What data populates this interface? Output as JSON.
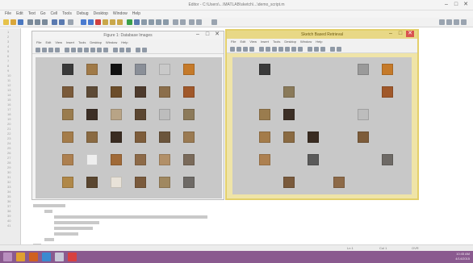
{
  "window": {
    "title": "Editor - C:\\Users\\...\\MATLAB\\sketch\\...\\demo_script.m",
    "controls": [
      "–",
      "□",
      "✕"
    ]
  },
  "menu": [
    "File",
    "Edit",
    "Text",
    "Go",
    "Cell",
    "Tools",
    "Debug",
    "Desktop",
    "Window",
    "Help"
  ],
  "editor": {
    "line_numbers": [
      "1",
      "2",
      "3",
      "4",
      "5",
      "6",
      "7",
      "8",
      "9",
      "10",
      "11",
      "12",
      "13",
      "14",
      "15",
      "16",
      "17",
      "18",
      "19",
      "20",
      "21",
      "22",
      "23",
      "24",
      "25",
      "26",
      "27",
      "28",
      "29",
      "30",
      "31",
      "32",
      "33",
      "34",
      "35",
      "36",
      "37",
      "38",
      "39",
      "40",
      "41"
    ]
  },
  "figure1": {
    "title": "Figure 1: Database Images",
    "controls": [
      "–",
      "□",
      "✕"
    ],
    "menu": [
      "File",
      "Edit",
      "View",
      "Insert",
      "Tools",
      "Desktop",
      "Window",
      "Help"
    ],
    "thumb_colors": [
      [
        "#3a3a3a",
        "#a07a48",
        "#111111",
        "#8a8f98",
        "#c9c9c9",
        "#c57a2a"
      ],
      [
        "#7a5a3a",
        "#5d4a36",
        "#6c4d2a",
        "#4d3a2c",
        "#8b6e4b",
        "#a0582a"
      ],
      [
        "#9a7c4e",
        "#3c2f26",
        "#b8a486",
        "#5b4631",
        "#bdbdbd",
        "#8c7a5a"
      ],
      [
        "#a47c4a",
        "#8a6a42",
        "#3a2c22",
        "#7d5c3a",
        "#6b553c",
        "#9a7a52"
      ],
      [
        "#ad8050",
        "#eeeeee",
        "#a06a38",
        "#8d6a48",
        "#b29068",
        "#7a6a5a"
      ],
      [
        "#b08848",
        "#5a4630",
        "#e8e2d8",
        "#7a5a3c",
        "#a08860",
        "#6e6a66"
      ]
    ]
  },
  "figure2": {
    "title": "Sketch Based Retrieval",
    "controls": [
      "–",
      "□",
      "✕"
    ],
    "menu": [
      "File",
      "Edit",
      "View",
      "Insert",
      "Tools",
      "Desktop",
      "Window",
      "Help"
    ],
    "thumb_colors": [
      "#3a3a3a",
      "#9a9a9a",
      "#c57a2a",
      "#8a7a5a",
      "#a0582a",
      "#9a7c4e",
      "#3c2f26",
      "#bdbdbd",
      "#a47c4a",
      "#8a6a42",
      "#3a2c22",
      "#7d5c3a",
      "#ad8050",
      "#5a5a5a",
      "#6e6a66",
      "#7a5a3c",
      "#8d6a48"
    ]
  },
  "status": {
    "left": "",
    "ln": "Ln 1",
    "col": "Col 1",
    "ovr": "OVR"
  },
  "taskbar": {
    "time": "10:45 AM",
    "date": "4/14/2015"
  }
}
